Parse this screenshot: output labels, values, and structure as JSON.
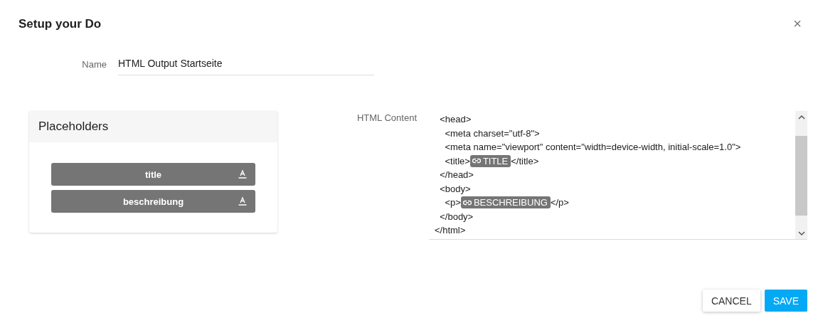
{
  "dialog": {
    "title": "Setup your Do",
    "close": "×"
  },
  "name_field": {
    "label": "Name",
    "value": "HTML Output Startseite"
  },
  "placeholders": {
    "title": "Placeholders",
    "items": [
      {
        "label": "title"
      },
      {
        "label": "beschreibung"
      }
    ]
  },
  "html_content": {
    "label": "HTML Content",
    "lines": [
      [
        {
          "kind": "text",
          "text": "  <head>"
        }
      ],
      [
        {
          "kind": "text",
          "text": "    <meta charset=\"utf-8\">"
        }
      ],
      [
        {
          "kind": "text",
          "text": "    <meta name=\"viewport\" content=\"width=device-width, initial-scale=1.0\">"
        }
      ],
      [
        {
          "kind": "text",
          "text": "    <title>"
        },
        {
          "kind": "chip",
          "text": "TITLE"
        },
        {
          "kind": "text",
          "text": "</title>"
        }
      ],
      [
        {
          "kind": "text",
          "text": "  </head>"
        }
      ],
      [
        {
          "kind": "text",
          "text": "  <body>"
        }
      ],
      [
        {
          "kind": "text",
          "text": "    <p>"
        },
        {
          "kind": "chip",
          "text": "BESCHREIBUNG"
        },
        {
          "kind": "text",
          "text": "</p>"
        }
      ],
      [
        {
          "kind": "text",
          "text": "  </body>"
        }
      ],
      [
        {
          "kind": "text",
          "text": "</html>"
        }
      ]
    ]
  },
  "buttons": [
    {
      "kind": "plain",
      "label": "CANCEL"
    },
    {
      "kind": "primary",
      "label": "SAVE"
    }
  ]
}
